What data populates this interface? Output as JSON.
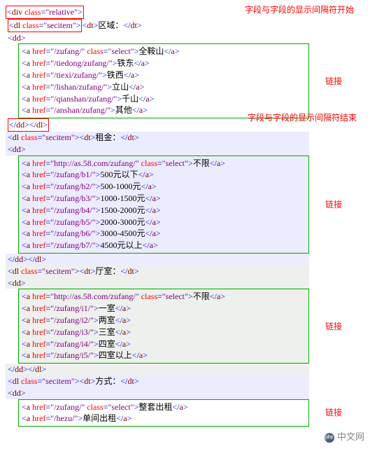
{
  "anno": {
    "sep_start": "字段与字段的显示间隔符开始",
    "sep_end": "字段与字段的显示间隔符结束",
    "link": "链接"
  },
  "code": {
    "open_div": {
      "tag": "div",
      "attrs": [
        [
          "class",
          "relative"
        ]
      ]
    },
    "sections": [
      {
        "dl_line": {
          "dl_class": "secitem",
          "dt_text": "区域：",
          "alt": false
        },
        "red_open": true,
        "dd_open": {
          "tag": "dd",
          "close": false
        },
        "box_bg": "",
        "links": [
          {
            "href": "/zufang/",
            "cls": "select",
            "text": "全鞍山"
          },
          {
            "href": "/tiedong/zufang/",
            "text": "铁东"
          },
          {
            "href": "/tiexi/zufang/",
            "text": "铁西"
          },
          {
            "href": "/lishan/zufang/",
            "text": "立山"
          },
          {
            "href": "/qianshan/zufang/",
            "text": "千山"
          },
          {
            "href": "/anshan/zufang/",
            "text": "其他"
          }
        ],
        "closing_red": true
      },
      {
        "dl_line": {
          "dl_class": "secitem",
          "dt_text": "租金：",
          "alt": true
        },
        "dd_open": {
          "tag": "dd"
        },
        "box_bg": "section-alt",
        "links": [
          {
            "href": "http://as.58.com/zufang/",
            "cls": "select",
            "text": "不限"
          },
          {
            "href": "/zufang/b1/",
            "text": "500元以下"
          },
          {
            "href": "/zufang/b2/",
            "text": "500-1000元"
          },
          {
            "href": "/zufang/b3/",
            "text": "1000-1500元"
          },
          {
            "href": "/zufang/b4/",
            "text": "1500-2000元"
          },
          {
            "href": "/zufang/b5/",
            "text": "2000-3000元"
          },
          {
            "href": "/zufang/b6/",
            "text": "3000-4500元"
          },
          {
            "href": "/zufang/b7/",
            "text": "4500元以上"
          }
        ],
        "closing_normal": true
      },
      {
        "dl_line": {
          "dl_class": "secitem",
          "dt_text": "厅室：",
          "alt": false,
          "bg": "section-gray"
        },
        "dd_open": {
          "tag": "dd",
          "bg": "section-gray"
        },
        "box_bg": "section-gray",
        "links": [
          {
            "href": "http://as.58.com/zufang/",
            "cls": "select",
            "text": "不限"
          },
          {
            "href": "/zufang/i1/",
            "text": "一室"
          },
          {
            "href": "/zufang/i2/",
            "text": "两室"
          },
          {
            "href": "/zufang/i3/",
            "text": "三室"
          },
          {
            "href": "/zufang/i4/",
            "text": "四室"
          },
          {
            "href": "/zufang/i5/",
            "text": "四室以上"
          }
        ],
        "closing_normal": true
      },
      {
        "dl_line": {
          "dl_class": "secitem",
          "dt_text": "方式：",
          "alt": true
        },
        "dd_open": {
          "tag": "dd"
        },
        "box_bg": "",
        "links": [
          {
            "href": "/zufang/",
            "cls": "select",
            "text": "整套出租"
          },
          {
            "href": "/hezu/",
            "text": "单间出租"
          }
        ]
      }
    ]
  },
  "logo_text": "中文网"
}
